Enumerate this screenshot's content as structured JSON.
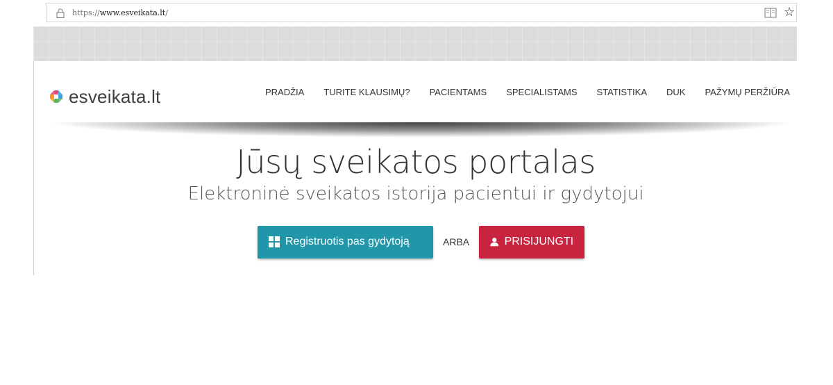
{
  "browser": {
    "url_scheme": "https://",
    "url_host": "www.esveikata.lt",
    "url_path": "/",
    "icons": [
      "lock-icon",
      "reader-view-icon",
      "star-icon"
    ]
  },
  "brand": {
    "name": "esveikata.lt",
    "colors": {
      "teal": "#2196a8",
      "red": "#c9243f",
      "pink": "#e64a7a",
      "blue": "#3aa0de",
      "orange": "#f29a32",
      "green": "#5bb75b"
    }
  },
  "nav": {
    "items": [
      {
        "label": "PRADŽIA"
      },
      {
        "label": "TURITE KLAUSIMŲ?"
      },
      {
        "label": "PACIENTAMS"
      },
      {
        "label": "SPECIALISTAMS"
      },
      {
        "label": "STATISTIKA"
      },
      {
        "label": "DUK"
      },
      {
        "label": "PAŽYMŲ PERŽIŪRA"
      }
    ]
  },
  "hero": {
    "title": "Jūsų sveikatos portalas",
    "subtitle": "Elektroninė sveikatos istorija pacientui ir gydytojui"
  },
  "cta": {
    "register_label": "Registruotis pas gydytoją",
    "or_label": "ARBA",
    "login_label": "PRISIJUNGTI"
  }
}
